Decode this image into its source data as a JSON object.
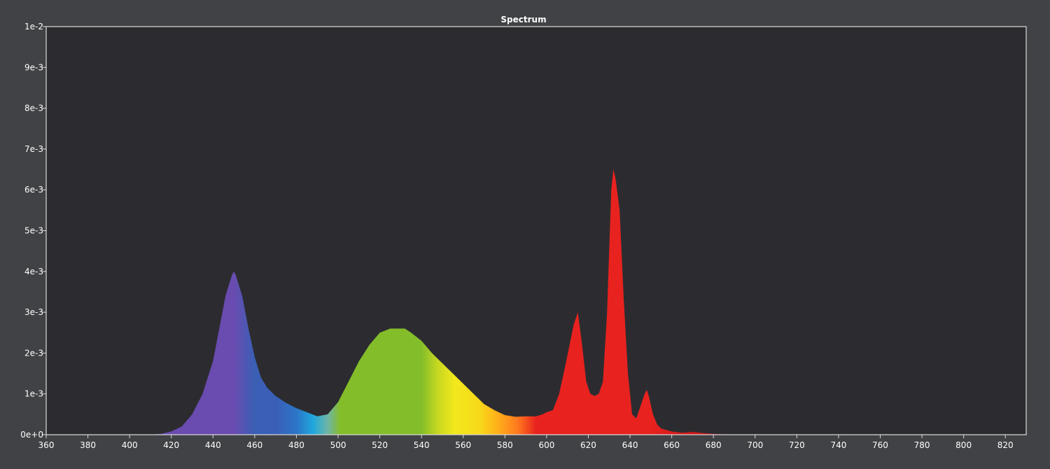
{
  "chart_data": {
    "type": "area",
    "title": "Spectrum",
    "xlabel": "",
    "ylabel": "",
    "xlim": [
      360,
      830
    ],
    "ylim": [
      0,
      0.01
    ],
    "grid": false,
    "legend": "none",
    "x_ticks": [
      360,
      380,
      400,
      420,
      440,
      460,
      480,
      500,
      520,
      540,
      560,
      580,
      600,
      620,
      640,
      660,
      680,
      700,
      720,
      740,
      760,
      780,
      800,
      820
    ],
    "x_tick_labels": [
      "360",
      "380",
      "400",
      "420",
      "440",
      "460",
      "480",
      "500",
      "520",
      "540",
      "560",
      "580",
      "600",
      "620",
      "640",
      "660",
      "680",
      "700",
      "720",
      "740",
      "760",
      "780",
      "800",
      "820"
    ],
    "y_ticks": [
      0,
      0.001,
      0.002,
      0.003,
      0.004,
      0.005,
      0.006,
      0.007,
      0.008,
      0.009,
      0.01
    ],
    "y_tick_labels": [
      "0e+0",
      "1e-3",
      "2e-3",
      "3e-3",
      "4e-3",
      "5e-3",
      "6e-3",
      "7e-3",
      "8e-3",
      "9e-3",
      "1e-2"
    ],
    "series": [
      {
        "x": [
          400,
          410,
          415,
          420,
          425,
          430,
          435,
          440,
          443,
          446,
          449,
          450,
          451,
          454,
          457,
          460,
          463,
          466,
          470,
          475,
          480,
          485,
          490,
          495,
          500,
          505,
          510,
          515,
          520,
          525,
          530,
          532,
          535,
          540,
          545,
          550,
          555,
          560,
          565,
          570,
          575,
          580,
          585,
          590,
          595,
          598,
          600,
          603,
          606,
          609,
          611,
          613,
          615,
          617,
          619,
          621,
          623,
          625,
          627,
          629,
          631,
          632,
          633,
          635,
          637,
          639,
          641,
          643,
          645,
          647,
          648,
          649,
          651,
          653,
          655,
          660,
          665,
          670,
          675,
          680,
          690,
          700
        ],
        "y": [
          0,
          0,
          2e-05,
          8e-05,
          0.0002,
          0.0005,
          0.001,
          0.0018,
          0.0026,
          0.0034,
          0.0039,
          0.004,
          0.0039,
          0.0034,
          0.0026,
          0.0019,
          0.0014,
          0.00115,
          0.00095,
          0.00078,
          0.00065,
          0.00055,
          0.00045,
          0.0005,
          0.0008,
          0.0013,
          0.0018,
          0.0022,
          0.0025,
          0.0026,
          0.0026,
          0.0026,
          0.0025,
          0.0023,
          0.002,
          0.00175,
          0.0015,
          0.00125,
          0.001,
          0.00075,
          0.0006,
          0.00048,
          0.00044,
          0.00045,
          0.00045,
          0.0005,
          0.00055,
          0.0006,
          0.001,
          0.0017,
          0.0022,
          0.0027,
          0.003,
          0.0022,
          0.0013,
          0.001,
          0.00095,
          0.001,
          0.0013,
          0.003,
          0.006,
          0.0065,
          0.0063,
          0.0055,
          0.0033,
          0.0015,
          0.0005,
          0.0004,
          0.0007,
          0.001,
          0.0011,
          0.00095,
          0.0005,
          0.00025,
          0.00015,
          8e-05,
          5e-05,
          7e-05,
          4e-05,
          2e-05,
          0,
          0
        ]
      }
    ],
    "fill_colors": {
      "violet": "#6A4BB0",
      "blue": "#3A5FB5",
      "cyan": "#1FA8DC",
      "green": "#84BD2A",
      "yellow": "#F2E81C",
      "orange": "#FF9F1A",
      "red": "#E8221F"
    }
  },
  "colors": {
    "page_bg": "#414245",
    "plot_bg": "#2C2C30",
    "axis": "#DCDCDC",
    "text": "#FFFFFF"
  }
}
